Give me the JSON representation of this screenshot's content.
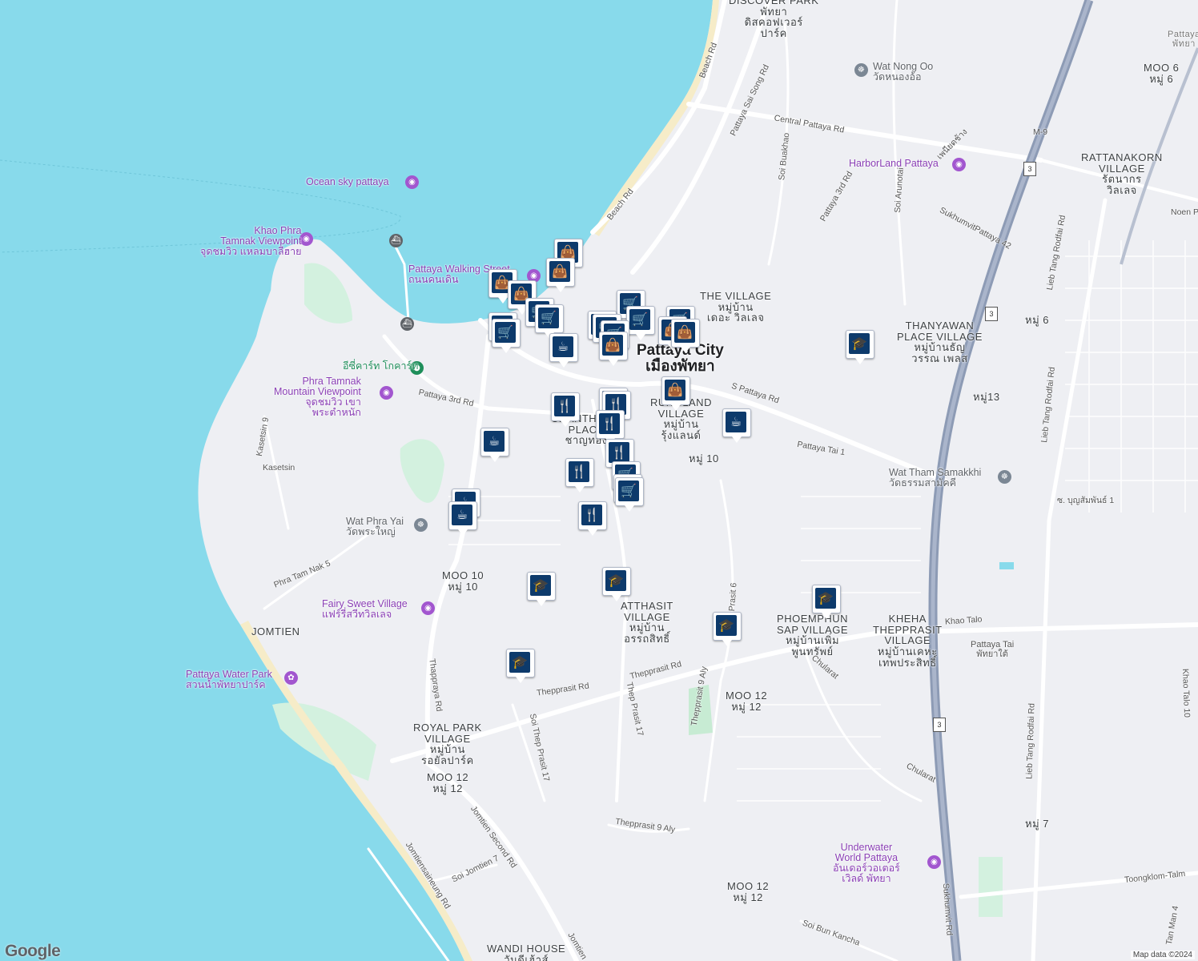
{
  "colors": {
    "water": "#88daeb",
    "land": "#eeeff3",
    "park": "#d3f1df",
    "road": "#ffffff",
    "highway": "#8d9bb5",
    "marker": "#0d3a6b",
    "beach": "#f6ecc8"
  },
  "labels": {
    "discover_park": "DISCOVER PARK",
    "discover_park_th": "พัทยา\nดิสคอฟเวอร์\nปาร์ค",
    "pattaya": "Pattaya",
    "pattaya_th": "พัทยา",
    "moo6": "MOO 6\nหมู่ 6",
    "m9": "M-9",
    "rattanakorn": "RATTANAKORN\nVILLAGE\nรัตนากร\nวิลเลจ",
    "noen": "Noen P",
    "the_village": "THE VILLAGE\nหมู่บ้าน\nเดอะ วิลเลจ",
    "thanyawan": "THANYAWAN\nPLACE VILLAGE\nหมู่บ้านธัญ\nวรรณ เพลส",
    "moo6_th": "หมู่ 6",
    "moo13": "หมู่13",
    "pattaya_city": "Pattaya City\nเมืองพัทยา",
    "rungland": "RUNGLAND\nVILLAGE\nหมู่บ้าน\nรุ้งแลนด์",
    "chanthong": "CHANTHONG\nPLACE\nชาญทอง",
    "moo10_a": "หมู่ 10",
    "moo10_b": "MOO 10\nหมู่ 10",
    "jomtien": "JOMTIEN",
    "atthasit": "ATTHASIT\nVILLAGE\nหมู่บ้าน\nอรรถสิทธิ์",
    "phoemphun": "PHOEMPHUN\nSAP VILLAGE\nหมู่บ้านเพิ่ม\nพูนทรัพย์",
    "khehathepprasit": "KHEHA\nTHEPPRASIT\nVILLAGE\nหมู่บ้านเคหะ\nเทพประสิทธิ์",
    "moo12_a": "MOO 12\nหมู่ 12",
    "moo12_b": "MOO 12\nหมู่ 12",
    "moo12_c": "MOO 12\nหมู่ 12",
    "royal_park": "ROYAL PARK\nVILLAGE\nหมู่บ้าน\nรอยัลปาร์ค",
    "moo7": "หมู่ 7",
    "pattaya_tai": "Pattaya Tai\nพัทยาใต้",
    "wandi": "WANDI HOUSE\nวันดีเฮ้าส์",
    "kasetsin": "Kasetsin"
  },
  "roads": {
    "beach_rd": "Beach Rd",
    "beach_rd2": "Beach Rd",
    "pattaya_sai_song": "Pattaya Sai Song Rd",
    "central_pattaya": "Central Pattaya Rd",
    "soi_buakhao": "Soi Buakhao",
    "pattaya_3rd": "Pattaya 3rd Rd",
    "pattaya_3rd_b": "Pattaya 3rd Rd",
    "soi_arunotai": "Soi Arunotai",
    "sukhumvit_42": "SukhumvitPattaya 42",
    "phetcharat": "เพนียดช้าง",
    "lieb_tang_1": "Lieb Tang Rodfai Rd",
    "lieb_tang_2": "Lieb Tang Rodfai Rd",
    "lieb_tang_3": "Lieb Tang Rodfai Rd",
    "s_pattaya": "S Pattaya Rd",
    "pattaya_tai_1": "Pattaya Tai 1",
    "soi_boonsampan": "ซ. บุญสัมพันธ์ 1",
    "thepprasit_1": "Thepprasit Rd",
    "thepprasit_2": "Thepprasit Rd",
    "thappraya": "Thappraya Rd",
    "khao_talo": "Khao Talo",
    "khao_talo_10": "Khao Talo 10",
    "chularat": "Chularat",
    "chularat_2": "Chularat",
    "phra_tam_nak_5": "Phra Tam Nak 5",
    "kasetsin_9": "Kasetsin 9",
    "soi_thep_prasit_17": "Soi Thep Prasit 17",
    "thep_prasit_17": "Thep Prasit 17",
    "thepprasit_9_aly": "Thepprasit 9 Aly",
    "thepprasit_9_aly_2": "Thepprasit 9 Aly",
    "prasit_6": "Prasit 6",
    "jomtien_second": "Jomtien Second Rd",
    "jomtiensaineung": "Jomtiensaineung Rd",
    "soi_jomtien_7": "Soi Jomtien 7",
    "soi_bun_kanchana": "Soi Bun Kancha",
    "toongklom": "Toongklom-Talm",
    "sukhumvit_rd": "Sukhumvit Rd",
    "jomtien_rd": "Jomtien",
    "tan_man_4": "Tan Man 4",
    "shield_3a": "3",
    "shield_3b": "3",
    "shield_3c": "3"
  },
  "pois": {
    "wat_nong_oo": "Wat Nong Oo\nวัดหนองอ้อ",
    "harborland": "HarborLand Pattaya",
    "ocean_sky": "Ocean sky pattaya",
    "khao_phra_tamnak": "Khao Phra\nTamnak Viewpoint\nจุดชมวิว แหลมบาลีฮาย",
    "walking_street": "Pattaya Walking Street\nถนนคนเดิน",
    "ecourt": "อีซี่คาร์ท โกคาร์ท",
    "phra_tamnak_mountain": "Phra Tamnak\nMountain Viewpoint\nจุดชมวิว เขา\nพระตำหนัก",
    "wat_phra_yai": "Wat Phra Yai\nวัดพระใหญ่",
    "fairy_sweet": "Fairy Sweet Village\nแฟร์รี่สวีทวิลเลจ",
    "water_park": "Pattaya Water Park\nสวนน้ำพัทยาปาร์ค",
    "wat_tham": "Wat Tham Samakkhi\nวัดธรรมสามัคคี",
    "underwater_world": "Underwater\nWorld Pattaya\nอันเดอร์วอเตอร์\nเวิลด์ พัทยา"
  },
  "markers": [
    {
      "type": "shopping-bag"
    },
    {
      "type": "shopping-bag"
    },
    {
      "type": "shopping-bag"
    },
    {
      "type": "shopping-bag"
    },
    {
      "type": "cart"
    },
    {
      "type": "cart"
    },
    {
      "type": "cart"
    },
    {
      "type": "cart"
    },
    {
      "type": "cart"
    },
    {
      "type": "cart"
    },
    {
      "type": "cart"
    },
    {
      "type": "cart"
    },
    {
      "type": "cart"
    },
    {
      "type": "cart"
    },
    {
      "type": "shopping-bag"
    },
    {
      "type": "shopping-bag"
    },
    {
      "type": "shopping-bag"
    },
    {
      "type": "coffee"
    },
    {
      "type": "coffee"
    },
    {
      "type": "coffee"
    },
    {
      "type": "coffee"
    },
    {
      "type": "coffee"
    },
    {
      "type": "restaurant"
    },
    {
      "type": "restaurant"
    },
    {
      "type": "restaurant"
    },
    {
      "type": "restaurant"
    },
    {
      "type": "restaurant"
    },
    {
      "type": "restaurant"
    },
    {
      "type": "restaurant"
    },
    {
      "type": "cart"
    },
    {
      "type": "cart"
    },
    {
      "type": "cart"
    },
    {
      "type": "shopping-bag"
    },
    {
      "type": "school"
    },
    {
      "type": "school"
    },
    {
      "type": "school"
    },
    {
      "type": "school"
    },
    {
      "type": "school"
    },
    {
      "type": "school"
    }
  ],
  "icons": {
    "shopping-bag": "👜",
    "cart": "🛒",
    "coffee": "☕",
    "restaurant": "🍴",
    "school": "🎓"
  },
  "google_logo": "Google",
  "attribution": "Map data ©2024"
}
